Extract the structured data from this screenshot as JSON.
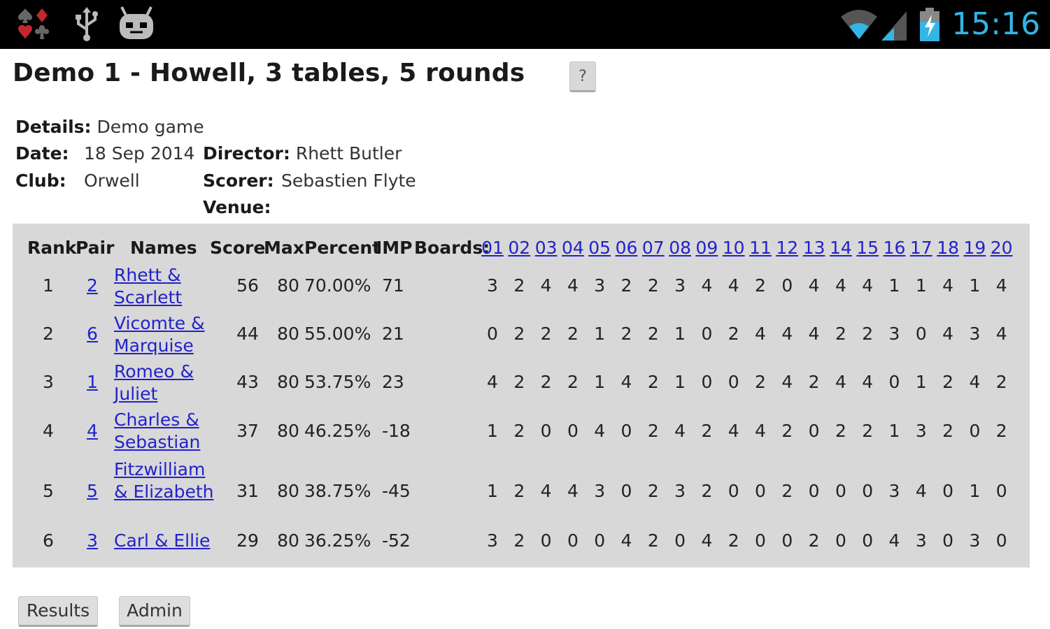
{
  "status_bar": {
    "icons": [
      "card-suits-icon",
      "usb-icon",
      "android-debug-icon",
      "wifi-icon",
      "cell-signal-icon",
      "battery-charging-icon"
    ],
    "time": "15:16",
    "accent": "#33b5e5"
  },
  "header": {
    "title": "Demo 1 - Howell, 3 tables, 5 rounds",
    "help_label": "?"
  },
  "info": {
    "details_label": "Details:",
    "details_value": "Demo game",
    "date_label": "Date:",
    "date_value": "18 Sep 2014",
    "club_label": "Club:",
    "club_value": "Orwell",
    "director_label": "Director:",
    "director_value": "Rhett Butler",
    "scorer_label": "Scorer:",
    "scorer_value": "Sebastien Flyte",
    "venue_label": "Venue:",
    "venue_value": ""
  },
  "table": {
    "headers": {
      "rank": "Rank",
      "pair": "Pair",
      "names": "Names",
      "score": "Score",
      "max": "Max",
      "percent": "Percent",
      "imp": "IMP",
      "boards": "Boards:"
    },
    "board_numbers": [
      "01",
      "02",
      "03",
      "04",
      "05",
      "06",
      "07",
      "08",
      "09",
      "10",
      "11",
      "12",
      "13",
      "14",
      "15",
      "16",
      "17",
      "18",
      "19",
      "20"
    ],
    "rows": [
      {
        "rank": "1",
        "pair": "2",
        "names": "Rhett & Scarlett",
        "score": "56",
        "max": "80",
        "percent": "70.00%",
        "imp": "71",
        "boards": [
          "3",
          "2",
          "4",
          "4",
          "3",
          "2",
          "2",
          "3",
          "4",
          "4",
          "2",
          "0",
          "4",
          "4",
          "4",
          "1",
          "1",
          "4",
          "1",
          "4"
        ]
      },
      {
        "rank": "2",
        "pair": "6",
        "names": "Vicomte & Marquise",
        "score": "44",
        "max": "80",
        "percent": "55.00%",
        "imp": "21",
        "boards": [
          "0",
          "2",
          "2",
          "2",
          "1",
          "2",
          "2",
          "1",
          "0",
          "2",
          "4",
          "4",
          "4",
          "2",
          "2",
          "3",
          "0",
          "4",
          "3",
          "4"
        ]
      },
      {
        "rank": "3",
        "pair": "1",
        "names": "Romeo & Juliet",
        "score": "43",
        "max": "80",
        "percent": "53.75%",
        "imp": "23",
        "boards": [
          "4",
          "2",
          "2",
          "2",
          "1",
          "4",
          "2",
          "1",
          "0",
          "0",
          "2",
          "4",
          "2",
          "4",
          "4",
          "0",
          "1",
          "2",
          "4",
          "2"
        ]
      },
      {
        "rank": "4",
        "pair": "4",
        "names": "Charles & Sebastian",
        "score": "37",
        "max": "80",
        "percent": "46.25%",
        "imp": "-18",
        "boards": [
          "1",
          "2",
          "0",
          "0",
          "4",
          "0",
          "2",
          "4",
          "2",
          "4",
          "4",
          "2",
          "0",
          "2",
          "2",
          "1",
          "3",
          "2",
          "0",
          "2"
        ]
      },
      {
        "rank": "5",
        "pair": "5",
        "names": "Fitzwilliam & Elizabeth",
        "score": "31",
        "max": "80",
        "percent": "38.75%",
        "imp": "-45",
        "boards": [
          "1",
          "2",
          "4",
          "4",
          "3",
          "0",
          "2",
          "3",
          "2",
          "0",
          "0",
          "2",
          "0",
          "0",
          "0",
          "3",
          "4",
          "0",
          "1",
          "0"
        ]
      },
      {
        "rank": "6",
        "pair": "3",
        "names": "Carl & Ellie",
        "score": "29",
        "max": "80",
        "percent": "36.25%",
        "imp": "-52",
        "boards": [
          "3",
          "2",
          "0",
          "0",
          "0",
          "4",
          "2",
          "0",
          "4",
          "2",
          "0",
          "0",
          "2",
          "0",
          "0",
          "4",
          "3",
          "0",
          "3",
          "0"
        ]
      }
    ]
  },
  "buttons": {
    "results": "Results",
    "admin": "Admin"
  }
}
